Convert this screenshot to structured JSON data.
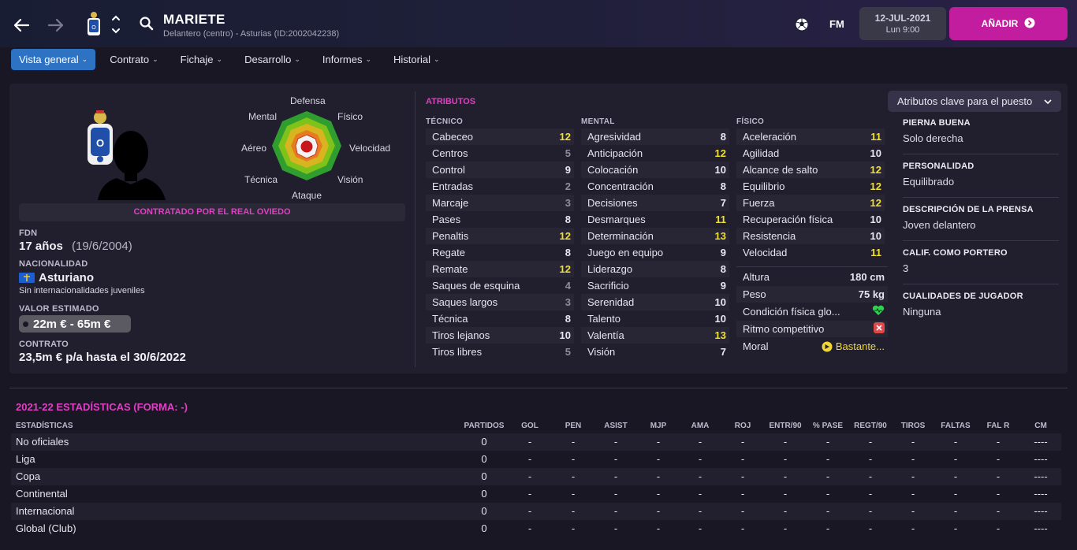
{
  "header": {
    "player_name": "MARIETE",
    "subtitle": "Delantero (centro) - Asturias (ID:2002042238)",
    "date": "12-JUL-2021",
    "day_time": "Lun 9:00",
    "fm_label": "FM",
    "add_label": "AÑADIR"
  },
  "tabs": [
    {
      "label": "Vista general",
      "active": true
    },
    {
      "label": "Contrato",
      "active": false
    },
    {
      "label": "Fichaje",
      "active": false
    },
    {
      "label": "Desarrollo",
      "active": false
    },
    {
      "label": "Informes",
      "active": false
    },
    {
      "label": "Historial",
      "active": false
    }
  ],
  "radar": {
    "labels": {
      "top": "Defensa",
      "tr": "Físico",
      "r": "Velocidad",
      "br": "Visión",
      "bottom": "Ataque",
      "bl": "Técnica",
      "l": "Aéreo",
      "tl": "Mental"
    }
  },
  "profile": {
    "contract_banner": "CONTRATADO POR EL REAL OVIEDO",
    "dob_label": "FDN",
    "age": "17 años",
    "dob": "(19/6/2004)",
    "nationality_label": "NACIONALIDAD",
    "nationality": "Asturiano",
    "caps": "Sin internacionalidades juveniles",
    "value_label": "VALOR ESTIMADO",
    "value": "22m € - 65m €",
    "contract_label": "CONTRATO",
    "contract": "23,5m € p/a hasta el 30/6/2022"
  },
  "attributes": {
    "title": "ATRIBUTOS",
    "tecnico_label": "TÉCNICO",
    "mental_label": "MENTAL",
    "fisico_label": "FÍSICO",
    "tecnico": [
      {
        "name": "Cabeceo",
        "value": "12",
        "color": "y"
      },
      {
        "name": "Centros",
        "value": "5",
        "color": "g"
      },
      {
        "name": "Control",
        "value": "9",
        "color": "w"
      },
      {
        "name": "Entradas",
        "value": "2",
        "color": "g"
      },
      {
        "name": "Marcaje",
        "value": "3",
        "color": "g"
      },
      {
        "name": "Pases",
        "value": "8",
        "color": "w"
      },
      {
        "name": "Penaltis",
        "value": "12",
        "color": "y"
      },
      {
        "name": "Regate",
        "value": "8",
        "color": "w"
      },
      {
        "name": "Remate",
        "value": "12",
        "color": "y"
      },
      {
        "name": "Saques de esquina",
        "value": "4",
        "color": "g"
      },
      {
        "name": "Saques largos",
        "value": "3",
        "color": "g"
      },
      {
        "name": "Técnica",
        "value": "8",
        "color": "w"
      },
      {
        "name": "Tiros lejanos",
        "value": "10",
        "color": "w"
      },
      {
        "name": "Tiros libres",
        "value": "5",
        "color": "g"
      }
    ],
    "mental": [
      {
        "name": "Agresividad",
        "value": "8",
        "color": "w"
      },
      {
        "name": "Anticipación",
        "value": "12",
        "color": "y"
      },
      {
        "name": "Colocación",
        "value": "10",
        "color": "w"
      },
      {
        "name": "Concentración",
        "value": "8",
        "color": "w"
      },
      {
        "name": "Decisiones",
        "value": "7",
        "color": "w"
      },
      {
        "name": "Desmarques",
        "value": "11",
        "color": "y"
      },
      {
        "name": "Determinación",
        "value": "13",
        "color": "y"
      },
      {
        "name": "Juego en equipo",
        "value": "9",
        "color": "w"
      },
      {
        "name": "Liderazgo",
        "value": "8",
        "color": "w"
      },
      {
        "name": "Sacrificio",
        "value": "9",
        "color": "w"
      },
      {
        "name": "Serenidad",
        "value": "10",
        "color": "w"
      },
      {
        "name": "Talento",
        "value": "10",
        "color": "w"
      },
      {
        "name": "Valentía",
        "value": "13",
        "color": "y"
      },
      {
        "name": "Visión",
        "value": "7",
        "color": "w"
      }
    ],
    "fisico": [
      {
        "name": "Aceleración",
        "value": "11",
        "color": "y"
      },
      {
        "name": "Agilidad",
        "value": "10",
        "color": "w"
      },
      {
        "name": "Alcance de salto",
        "value": "12",
        "color": "y"
      },
      {
        "name": "Equilibrio",
        "value": "12",
        "color": "y"
      },
      {
        "name": "Fuerza",
        "value": "12",
        "color": "y"
      },
      {
        "name": "Recuperación física",
        "value": "10",
        "color": "w"
      },
      {
        "name": "Resistencia",
        "value": "10",
        "color": "w"
      },
      {
        "name": "Velocidad",
        "value": "11",
        "color": "y"
      }
    ],
    "extra": {
      "height_label": "Altura",
      "height": "180 cm",
      "weight_label": "Peso",
      "weight": "75 kg",
      "condition_label": "Condición física glo...",
      "match_label": "Ritmo competitivo",
      "morale_label": "Moral",
      "morale": "Bastante..."
    }
  },
  "side": {
    "dropdown": "Atributos clave para el puesto",
    "items": [
      {
        "label": "PIERNA BUENA",
        "value": "Solo derecha"
      },
      {
        "label": "PERSONALIDAD",
        "value": "Equilibrado"
      },
      {
        "label": "DESCRIPCIÓN DE LA PRENSA",
        "value": "Joven delantero"
      },
      {
        "label": "CALIF. COMO PORTERO",
        "value": "3"
      },
      {
        "label": "CUALIDADES DE JUGADOR",
        "value": "Ninguna"
      }
    ]
  },
  "stats": {
    "title": "2021-22 ESTADÍSTICAS (FORMA: -)",
    "columns": [
      "ESTADÍSTICAS",
      "PARTIDOS",
      "GOL",
      "PEN",
      "ASIST",
      "MJP",
      "AMA",
      "ROJ",
      "ENTR/90",
      "% PASE",
      "REGT/90",
      "TIROS",
      "FALTAS",
      "FAL R",
      "CM"
    ],
    "rows": [
      {
        "name": "No oficiales",
        "partidos": "0",
        "dash": "-",
        "cm": "----"
      },
      {
        "name": "Liga",
        "partidos": "0",
        "dash": "-",
        "cm": "----"
      },
      {
        "name": "Copa",
        "partidos": "0",
        "dash": "-",
        "cm": "----"
      },
      {
        "name": "Continental",
        "partidos": "0",
        "dash": "-",
        "cm": "----"
      },
      {
        "name": "Internacional",
        "partidos": "0",
        "dash": "-",
        "cm": "----"
      },
      {
        "name": "Global (Club)",
        "partidos": "0",
        "dash": "-",
        "cm": "----"
      }
    ]
  },
  "colors": {
    "accent_pink": "#e23fc4",
    "add_button": "#c21d9e",
    "tab_active": "#2d72c3",
    "high_attr": "#f0e030"
  }
}
